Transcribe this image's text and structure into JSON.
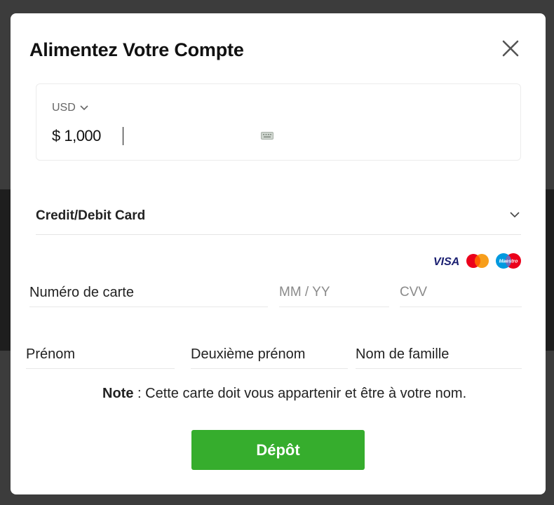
{
  "modal": {
    "title": "Alimentez Votre Compte",
    "close_icon": "close-icon"
  },
  "amount": {
    "currency": "USD",
    "value": "$ 1,000",
    "keyboard_icon": "keyboard-icon"
  },
  "payment_method": {
    "label": "Credit/Debit Card",
    "card_brands": [
      "VISA",
      "Mastercard",
      "Maestro"
    ]
  },
  "card_fields": {
    "card_number_label": "Numéro de carte",
    "expiry_placeholder": "MM / YY",
    "cvv_placeholder": "CVV"
  },
  "name_fields": {
    "first_name_label": "Prénom",
    "middle_name_label": "Deuxième prénom",
    "last_name_label": "Nom de famille"
  },
  "note": {
    "prefix": "Note",
    "text": " : Cette carte doit vous appartenir et être à votre nom."
  },
  "deposit_button": "Dépôt",
  "colors": {
    "primary_button": "#36ad2d",
    "visa_blue": "#1a1f71",
    "mastercard_red": "#eb001b",
    "mastercard_orange": "#f79e1b",
    "maestro_blue": "#0099df"
  }
}
